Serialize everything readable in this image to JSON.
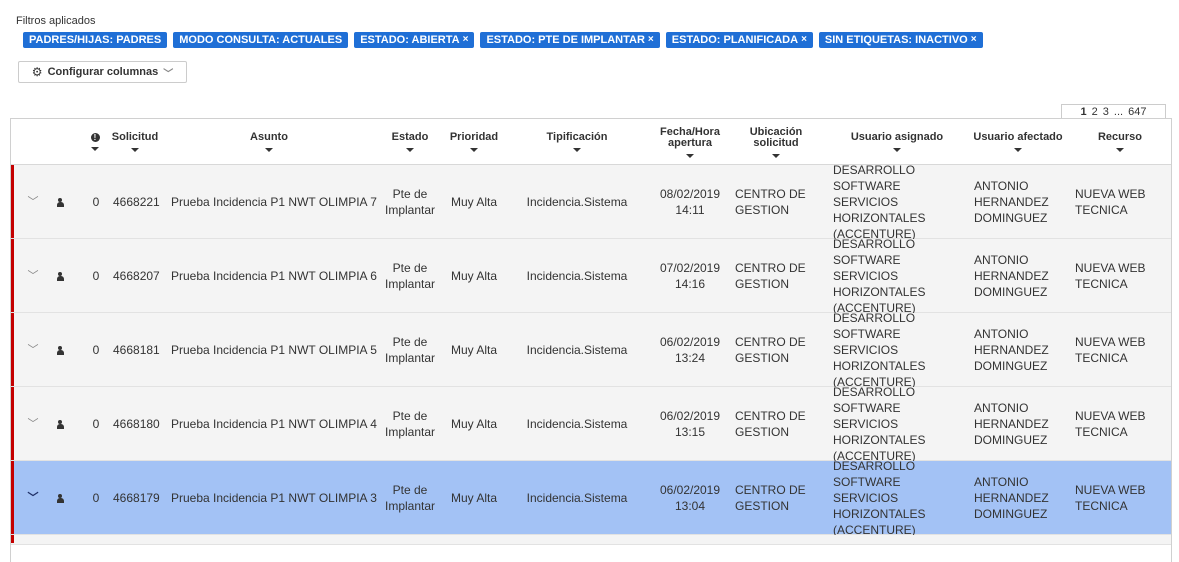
{
  "filters": {
    "title": "Filtros aplicados",
    "tags": [
      {
        "label": "PADRES/HIJAS: PADRES",
        "removable": false
      },
      {
        "label": "MODO CONSULTA: ACTUALES",
        "removable": false
      },
      {
        "label": "ESTADO: ABIERTA",
        "removable": true
      },
      {
        "label": "ESTADO: PTE DE IMPLANTAR",
        "removable": true
      },
      {
        "label": "ESTADO: PLANIFICADA",
        "removable": true
      },
      {
        "label": "SIN ETIQUETAS: INACTIVO",
        "removable": true
      }
    ],
    "remove_glyph": "×"
  },
  "toolbar": {
    "config_label": "Configurar columnas",
    "config_icon": "gear-icon",
    "chevron": "⌄"
  },
  "pagination": {
    "current": "1",
    "p2": "2",
    "p3": "3",
    "ellipsis": "...",
    "last": "647"
  },
  "table": {
    "headers": {
      "info": "!",
      "solicitud": "Solicitud",
      "asunto": "Asunto",
      "estado": "Estado",
      "prioridad": "Prioridad",
      "tipificacion": "Tipificación",
      "fecha_l1": "Fecha/Hora",
      "fecha_l2": "apertura",
      "ubicacion_l1": "Ubicación",
      "ubicacion_l2": "solicitud",
      "usuario_asignado": "Usuario asignado",
      "usuario_afectado": "Usuario afectado",
      "recurso": "Recurso"
    },
    "rows": [
      {
        "count": "0",
        "id": "4668221",
        "asunto": "Prueba Incidencia P1 NWT OLIMPIA 7",
        "estado_l1": "Pte de",
        "estado_l2": "Implantar",
        "prioridad": "Muy Alta",
        "tipificacion": "Incidencia.Sistema",
        "fecha": "08/02/2019",
        "hora": "14:11",
        "ubic_l1": "CENTRO DE",
        "ubic_l2": "GESTION",
        "asig_l1": "DESARROLLO",
        "asig_l2": "SOFTWARE SERVICIOS",
        "asig_l3": "HORIZONTALES",
        "asig_l4": "(ACCENTURE)",
        "afect_l1": "ANTONIO",
        "afect_l2": "HERNANDEZ",
        "afect_l3": "DOMINGUEZ",
        "rec_l1": "NUEVA WEB",
        "rec_l2": "TECNICA",
        "selected": false
      },
      {
        "count": "0",
        "id": "4668207",
        "asunto": "Prueba Incidencia P1 NWT OLIMPIA 6",
        "estado_l1": "Pte de",
        "estado_l2": "Implantar",
        "prioridad": "Muy Alta",
        "tipificacion": "Incidencia.Sistema",
        "fecha": "07/02/2019",
        "hora": "14:16",
        "ubic_l1": "CENTRO DE",
        "ubic_l2": "GESTION",
        "asig_l1": "DESARROLLO",
        "asig_l2": "SOFTWARE SERVICIOS",
        "asig_l3": "HORIZONTALES",
        "asig_l4": "(ACCENTURE)",
        "afect_l1": "ANTONIO",
        "afect_l2": "HERNANDEZ",
        "afect_l3": "DOMINGUEZ",
        "rec_l1": "NUEVA WEB",
        "rec_l2": "TECNICA",
        "selected": false
      },
      {
        "count": "0",
        "id": "4668181",
        "asunto": "Prueba Incidencia P1 NWT OLIMPIA 5",
        "estado_l1": "Pte de",
        "estado_l2": "Implantar",
        "prioridad": "Muy Alta",
        "tipificacion": "Incidencia.Sistema",
        "fecha": "06/02/2019",
        "hora": "13:24",
        "ubic_l1": "CENTRO DE",
        "ubic_l2": "GESTION",
        "asig_l1": "DESARROLLO",
        "asig_l2": "SOFTWARE SERVICIOS",
        "asig_l3": "HORIZONTALES",
        "asig_l4": "(ACCENTURE)",
        "afect_l1": "ANTONIO",
        "afect_l2": "HERNANDEZ",
        "afect_l3": "DOMINGUEZ",
        "rec_l1": "NUEVA WEB",
        "rec_l2": "TECNICA",
        "selected": false
      },
      {
        "count": "0",
        "id": "4668180",
        "asunto": "Prueba Incidencia P1 NWT OLIMPIA 4",
        "estado_l1": "Pte de",
        "estado_l2": "Implantar",
        "prioridad": "Muy Alta",
        "tipificacion": "Incidencia.Sistema",
        "fecha": "06/02/2019",
        "hora": "13:15",
        "ubic_l1": "CENTRO DE",
        "ubic_l2": "GESTION",
        "asig_l1": "DESARROLLO",
        "asig_l2": "SOFTWARE SERVICIOS",
        "asig_l3": "HORIZONTALES",
        "asig_l4": "(ACCENTURE)",
        "afect_l1": "ANTONIO",
        "afect_l2": "HERNANDEZ",
        "afect_l3": "DOMINGUEZ",
        "rec_l1": "NUEVA WEB",
        "rec_l2": "TECNICA",
        "selected": false
      },
      {
        "count": "0",
        "id": "4668179",
        "asunto": "Prueba Incidencia P1 NWT OLIMPIA 3",
        "estado_l1": "Pte de",
        "estado_l2": "Implantar",
        "prioridad": "Muy Alta",
        "tipificacion": "Incidencia.Sistema",
        "fecha": "06/02/2019",
        "hora": "13:04",
        "ubic_l1": "CENTRO DE",
        "ubic_l2": "GESTION",
        "asig_l1": "DESARROLLO",
        "asig_l2": "SOFTWARE SERVICIOS",
        "asig_l3": "HORIZONTALES",
        "asig_l4": "(ACCENTURE)",
        "afect_l1": "ANTONIO",
        "afect_l2": "HERNANDEZ",
        "afect_l3": "DOMINGUEZ",
        "rec_l1": "NUEVA WEB",
        "rec_l2": "TECNICA",
        "selected": true
      }
    ]
  },
  "colors": {
    "tag_bg": "#1f6fd6",
    "row_bg": "#f4f4f4",
    "selected_row_bg": "#a3c2f5",
    "priority_bar": "#c40000"
  }
}
